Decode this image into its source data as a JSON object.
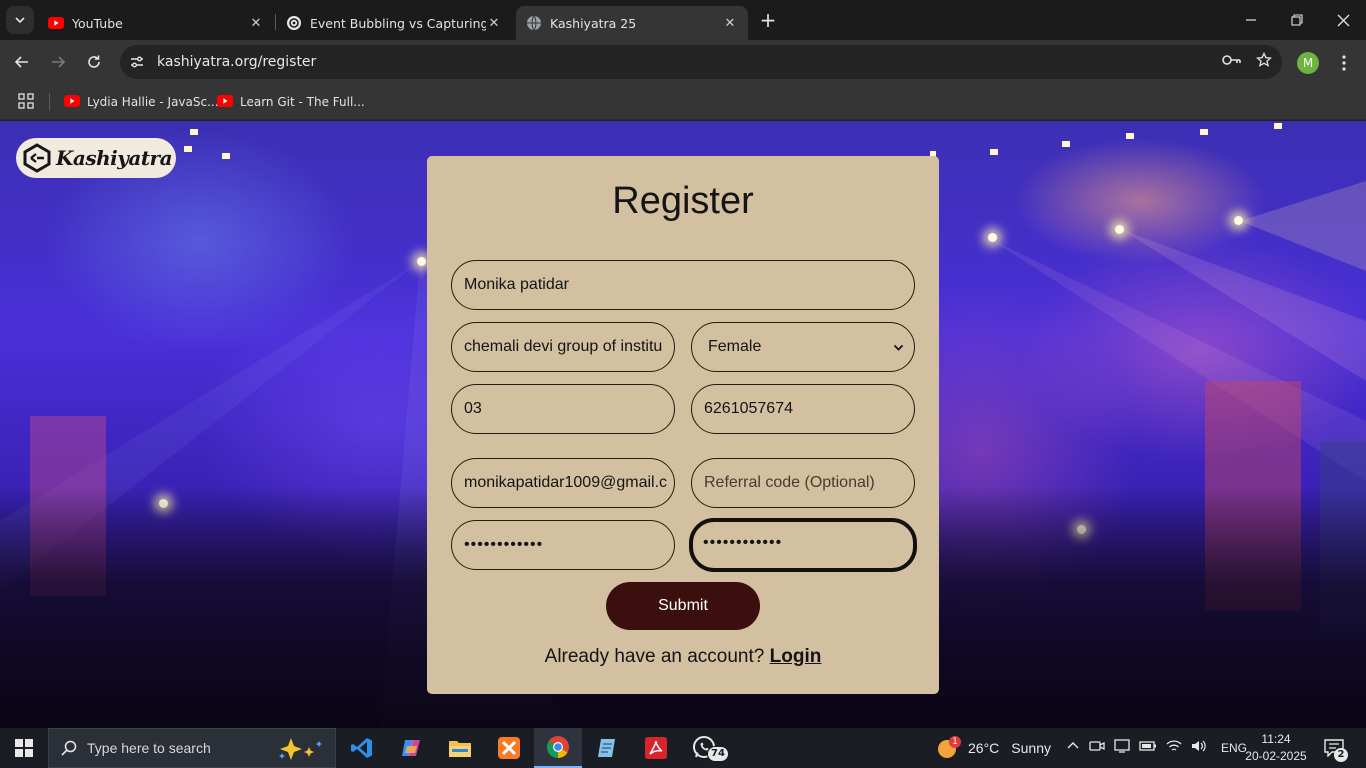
{
  "browser": {
    "tabs": [
      {
        "title": "YouTube",
        "favicon": "youtube-icon",
        "active": false
      },
      {
        "title": "Event Bubbling vs Capturing",
        "favicon": "chatgpt-icon",
        "active": false
      },
      {
        "title": "Kashiyatra 25",
        "favicon": "globe-icon",
        "active": true
      }
    ],
    "url": "kashiyatra.org/register",
    "profile_initial": "M",
    "bookmarks": [
      {
        "label": "Lydia Hallie - JavaSc...",
        "icon": "youtube-icon"
      },
      {
        "label": "Learn Git - The Full...",
        "icon": "youtube-icon"
      }
    ]
  },
  "page": {
    "logo_text": "Kashiyatra",
    "form": {
      "title": "Register",
      "name_value": "Monika patidar",
      "college_value": "chemali devi group of institu",
      "gender_selected": "Female",
      "year_value": "03",
      "phone_value": "6261057674",
      "email_value": "monikapatidar1009@gmail.c",
      "referral_placeholder": "Referral code (Optional)",
      "password_mask": "••••••••••••",
      "confirm_password_mask": "••••••••••••",
      "submit_label": "Submit",
      "have_account_text": "Already have an account?",
      "login_link": "Login"
    }
  },
  "taskbar": {
    "search_placeholder": "Type here to search",
    "whatsapp_badge": "74",
    "weather_badge": "1",
    "weather_temp": "26°C",
    "weather_desc": "Sunny",
    "language": "ENG",
    "time": "11:24",
    "date": "20-02-2025",
    "notification_count": "2"
  },
  "colors": {
    "card_bg": "#d2c0a0",
    "submit_bg": "#3b0f0d",
    "browser_toolbar": "#353535",
    "taskbar_bg": "#1a1d24"
  }
}
